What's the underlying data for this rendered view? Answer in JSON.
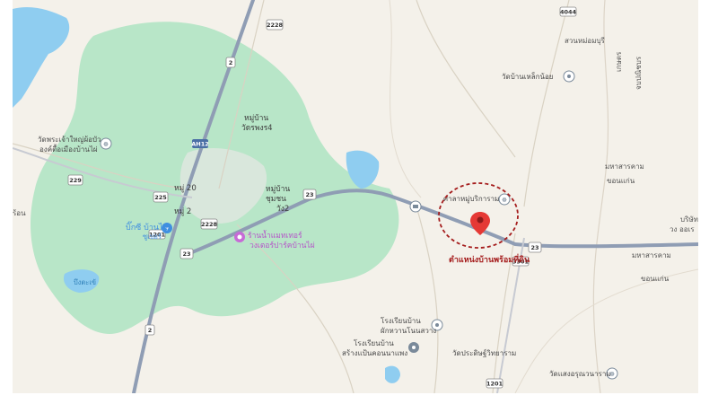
{
  "map": {
    "marker_label": "ตำแหน่งบ้านพร้อมที่ดิน",
    "marker_color": "#e53935",
    "circle_color": "#a51d1d",
    "forest_color": "#b8e6c8",
    "water_color": "#8fcdf0",
    "highway_color": "#8f9db4",
    "labels": {
      "mu20": "หมู่ 20",
      "mu2": "หมู่ 2",
      "mu_ban_north": "หมู่บ้าน",
      "mu_ban_north2": "วัดรพงร4",
      "mu_ban_mid": "หมู่บ้าน",
      "mu_ban_mid2": "ชุมชน",
      "mu_ban_mid3": "วัง2",
      "temple_left1": "วัดพระเจ้าใหญ่ผ้อบัว",
      "temple_left2": "องค์ตื้อเมืองบ้านไผ่",
      "bigc1": "บิ๊กซี บ้านไผ่",
      "bigc2": "ซูเปอร์",
      "lotus1": "ร้านน้ำแมทเทอร์",
      "lotus2": "วงเตอร์ปาร์คบ้านไผ่",
      "pond_left": "บึงตะเข้",
      "wat_north_right": "วัดบ้านเหล็กน้อย",
      "suan_north": "สวนหม่อมบุรี",
      "kaset": "เกษตร",
      "kaset2": "จบปณิชบร",
      "mahasarakham1": "มหาสารคาม",
      "khonkaen1": "ขอนแก่น",
      "mahasarakham2": "มหาสารคาม",
      "khonkaen2": "ขอนแก่น",
      "edge_right1": "บริษัท",
      "edge_right2": "วง ออเร",
      "wat_near_marker": "ศาลาหมู่บริการาม",
      "school1a": "โรงเรียนบ้าน",
      "school1b": "ผักหวานโนนสวาง",
      "school2a": "โรงเรียนบ้าน",
      "school2b": "สร้างแป้นคอนนาแพง",
      "wat_bottom": "วัดประดิษฐ์วิทยาราม",
      "wat_bottom_right": "วัดแสงอรุณวนาราม",
      "edge_left": "ร้อน"
    },
    "shields": {
      "s2228_top": "2228",
      "s2_top": "2",
      "s229": "229",
      "s225": "225",
      "s2228_mid": "2228",
      "s23_mid": "23",
      "s23_left": "23",
      "s1201": "1201",
      "s23_right": "23",
      "s3301": "3301",
      "s2_bottom": "2",
      "s1201_bottom": "1201",
      "s4044": "4044",
      "ah12": "AH12"
    }
  }
}
